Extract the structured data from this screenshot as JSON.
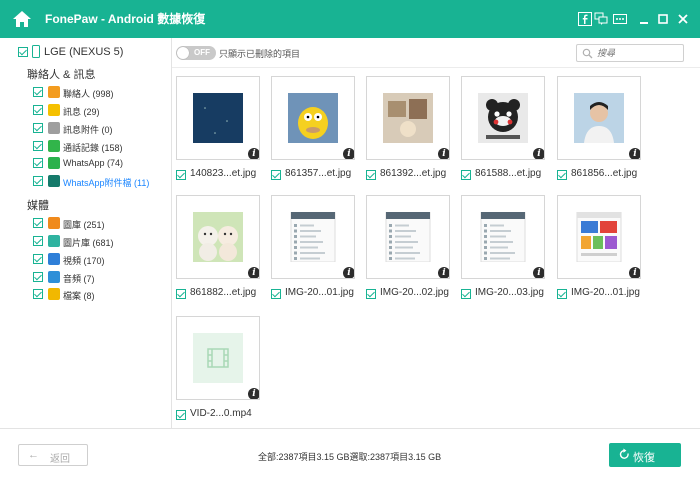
{
  "window": {
    "title": "FonePaw - Android 數據恢復"
  },
  "sidebar": {
    "device_label": "LGE (NEXUS 5)",
    "sections": [
      {
        "title": "聯絡人 & 訊息",
        "items": [
          {
            "label": "聯絡人 (998)",
            "icon": "contacts-icon",
            "color": "#f39c1f",
            "active": false
          },
          {
            "label": "訊息 (29)",
            "icon": "messages-icon",
            "color": "#f5c000",
            "active": false
          },
          {
            "label": "訊息附件 (0)",
            "icon": "message-attachments-icon",
            "color": "#9e9e9e",
            "active": false
          },
          {
            "label": "通話記錄 (158)",
            "icon": "call-log-icon",
            "color": "#31b54a",
            "active": false
          },
          {
            "label": "WhatsApp (74)",
            "icon": "whatsapp-icon",
            "color": "#2bb24c",
            "active": false
          },
          {
            "label": "WhatsApp附件檔 (11)",
            "icon": "whatsapp-attachments-icon",
            "color": "#167a6b",
            "active": true
          }
        ]
      },
      {
        "title": "媒體",
        "items": [
          {
            "label": "圖庫 (251)",
            "icon": "gallery-icon",
            "color": "#f08a1c",
            "active": false
          },
          {
            "label": "圖片庫 (681)",
            "icon": "picture-library-icon",
            "color": "#2fb3a0",
            "active": false
          },
          {
            "label": "視頻 (170)",
            "icon": "video-icon",
            "color": "#2e7fd8",
            "active": false
          },
          {
            "label": "音頻 (7)",
            "icon": "audio-icon",
            "color": "#2e8fd8",
            "active": false
          },
          {
            "label": "檔案 (8)",
            "icon": "documents-icon",
            "color": "#f1b800",
            "active": false
          }
        ]
      }
    ]
  },
  "toolbar": {
    "toggle_text": "OFF",
    "toggle_label": "只顯示已刪除的項目",
    "search_placeholder": "搜尋"
  },
  "files": [
    {
      "name": "140823...et.jpg",
      "thumb": "dark-blue"
    },
    {
      "name": "861357...et.jpg",
      "thumb": "cartoon"
    },
    {
      "name": "861392...et.jpg",
      "thumb": "photo"
    },
    {
      "name": "861588...et.jpg",
      "thumb": "bear"
    },
    {
      "name": "861856...et.jpg",
      "thumb": "person"
    },
    {
      "name": "861882...et.jpg",
      "thumb": "teddy"
    },
    {
      "name": "IMG-20...01.jpg",
      "thumb": "screen"
    },
    {
      "name": "IMG-20...02.jpg",
      "thumb": "screen"
    },
    {
      "name": "IMG-20...03.jpg",
      "thumb": "screen"
    },
    {
      "name": "IMG-20...01.jpg",
      "thumb": "store"
    },
    {
      "name": "VID-2...0.mp4",
      "thumb": "video"
    }
  ],
  "footer": {
    "back_label": "返回",
    "status": "全部:2387項目3.15 GB選取:2387項目3.15 GB",
    "recover_label": "恢復"
  },
  "colors": {
    "accent": "#18b393",
    "active_text": "#1a85ff"
  }
}
